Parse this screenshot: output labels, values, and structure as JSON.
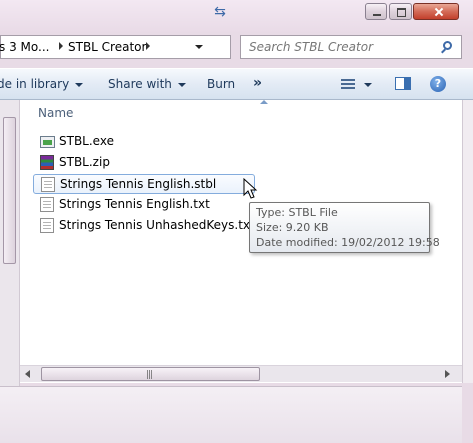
{
  "breadcrumbs": [
    "s 3 Mo...",
    "STBL Creator"
  ],
  "search": {
    "placeholder": "Search STBL Creator"
  },
  "toolbar": {
    "include_in_library": "de in library",
    "share_with": "Share with",
    "burn": "Burn",
    "more": "»"
  },
  "columns": {
    "name": "Name"
  },
  "files": [
    {
      "name": "STBL.exe",
      "icon": "exe-icon"
    },
    {
      "name": "STBL.zip",
      "icon": "winrar-archive-icon"
    },
    {
      "name": "Strings Tennis English.stbl",
      "icon": "document-icon"
    },
    {
      "name": "Strings Tennis English.txt",
      "icon": "text-file-icon"
    },
    {
      "name": "Strings Tennis UnhashedKeys.txt",
      "icon": "text-file-icon"
    }
  ],
  "tooltip": {
    "type": "Type: STBL File",
    "size": "Size: 9.20 KB",
    "date": "Date modified: 19/02/2012 19:58"
  },
  "scrollbar": {
    "grip": "|||"
  },
  "colors": {
    "accent": "#1e395b",
    "selection_border": "#84acdd",
    "window_frame": "#e8dbe6"
  }
}
